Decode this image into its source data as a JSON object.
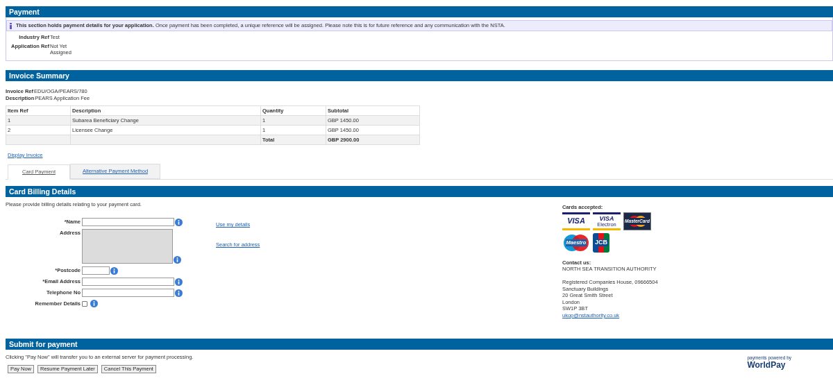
{
  "payment": {
    "title": "Payment",
    "notice": "**This section holds payment details for your application.** Once payment has been completed, a unique reference will be assigned. Please note this is for future reference and any communication with the NSTA.",
    "fields": [
      {
        "label": "Industry Ref",
        "value": "Test"
      },
      {
        "label": "Application Ref",
        "value": "Not Yet Assigned"
      }
    ]
  },
  "invoice": {
    "title": "Invoice Summary",
    "fields": [
      {
        "label": "Invoice Ref",
        "value": "EDU/OGA/PEARS/780"
      },
      {
        "label": "Description",
        "value": "PEARS Application Fee"
      }
    ],
    "table": {
      "columns": [
        "Item Ref",
        "Description",
        "Quantity",
        "Subtotal"
      ],
      "rows": [
        {
          "kind": "item",
          "cells": [
            "1",
            "Subarea Beneficiary Change",
            "1",
            "GBP 1450.00"
          ]
        },
        {
          "kind": "item",
          "cells": [
            "2",
            "Licensee Change",
            "1",
            "GBP 1450.00"
          ]
        },
        {
          "kind": "total",
          "label": "Total",
          "amount": "GBP 2900.00"
        }
      ]
    },
    "link": "Display Invoice"
  },
  "tabs": [
    {
      "label": "Card Payment",
      "selected": true
    },
    {
      "label": "Alternative Payment Method",
      "selected": false
    }
  ],
  "billing": {
    "title": "Card Billing Details",
    "intro": "Please provide billing details relating to your payment card.",
    "fields": [
      {
        "label": "*Name",
        "kind": "text"
      },
      {
        "label": "Address",
        "kind": "textarea"
      },
      {
        "label": "*Postcode",
        "kind": "short"
      },
      {
        "label": "*Email Address",
        "kind": "text"
      },
      {
        "label": "Telephone No",
        "kind": "text"
      },
      {
        "label": "Remember Details",
        "kind": "checkbox",
        "checked": false
      }
    ],
    "links": [
      "Use my details",
      "Search for address"
    ],
    "cards_title": "Cards accepted:",
    "cards": [
      {
        "kind": "visa",
        "label": "VISA"
      },
      {
        "kind": "visa-electron",
        "label": "VISA",
        "sublabel": "Electron"
      },
      {
        "kind": "mastercard",
        "label": "MasterCard"
      },
      {
        "kind": "maestro",
        "label": "Maestro"
      },
      {
        "kind": "jcb",
        "label": "JCB"
      }
    ],
    "contact_title": "Contact us:",
    "contact_lines": [
      "NORTH SEA TRANSITION AUTHORITY",
      "Registered Companies House, 09666504",
      "Sanctuary Buildings",
      "20 Great Smith Street",
      "London",
      "SW1P 3BT"
    ],
    "email": "ukop@nstauthority.co.uk"
  },
  "submit": {
    "title": "Submit for payment",
    "text": "Clicking \"Pay Now\" will transfer you to an external server for payment processing.",
    "buttons": [
      "Pay Now",
      "Resume Payment Later",
      "Cancel This Payment"
    ],
    "tagline": "payments powered by",
    "brand": "WorldPay"
  }
}
